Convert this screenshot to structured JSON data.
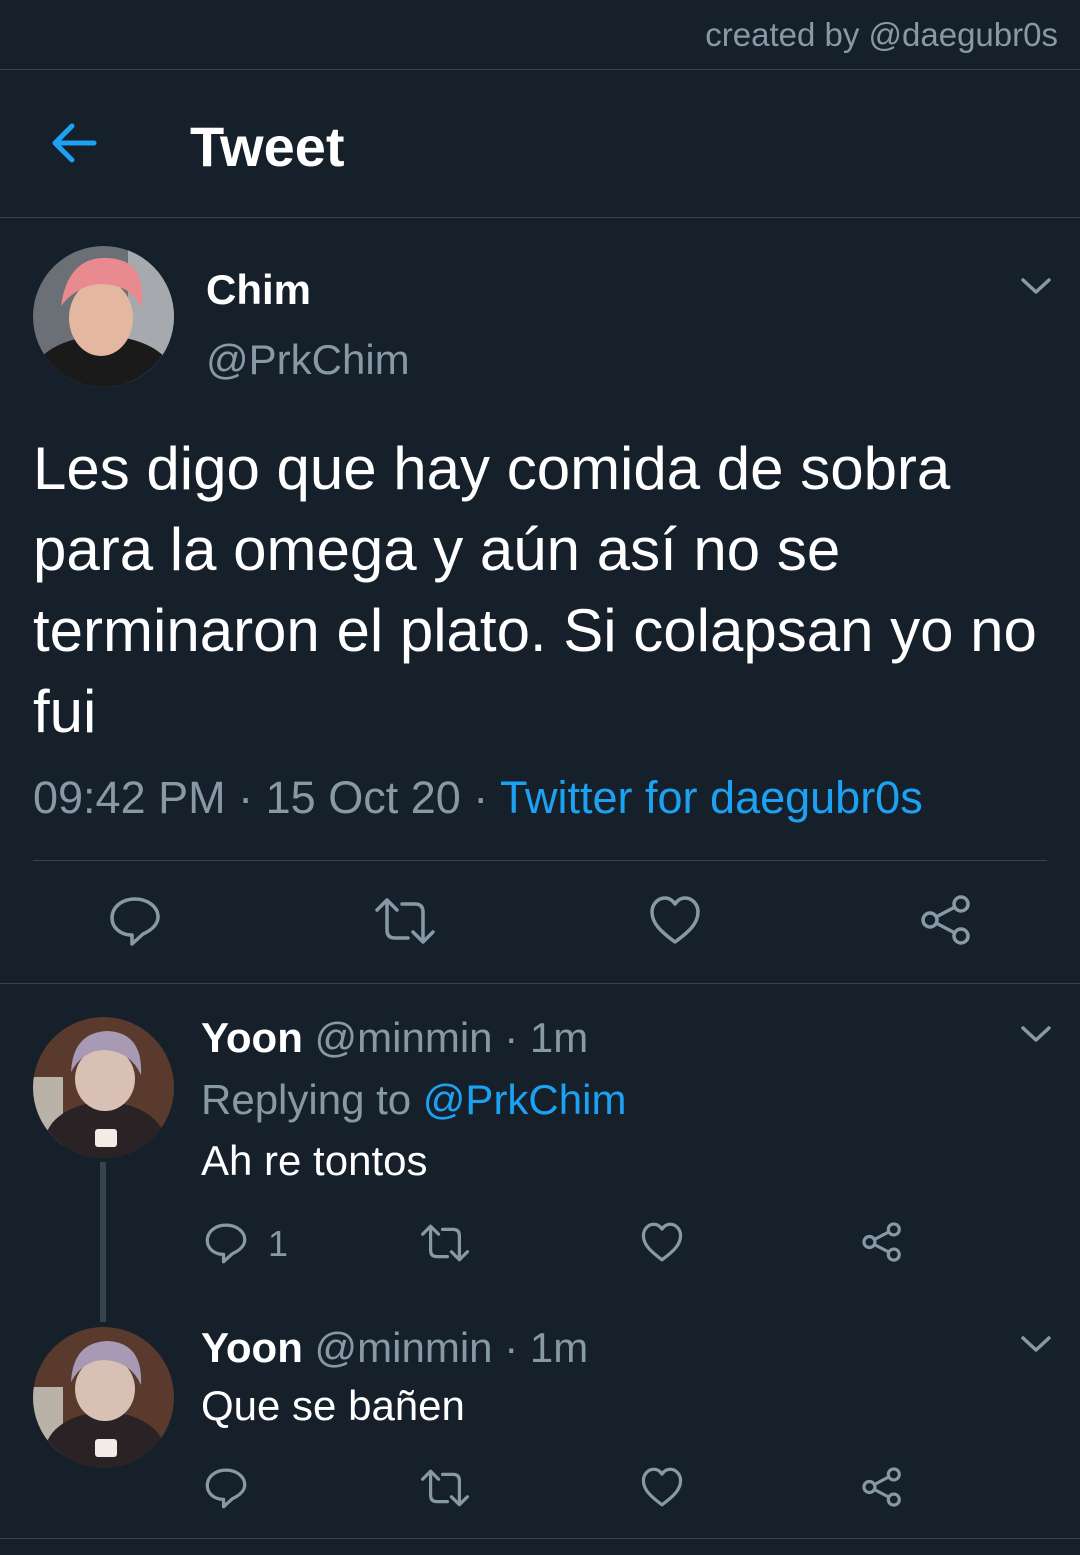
{
  "credit": "created by @daegubr0s",
  "header": {
    "title": "Tweet",
    "back_icon": "arrow-left-icon"
  },
  "colors": {
    "background": "#15202b",
    "accent": "#1da1f2",
    "muted": "#8899a6",
    "divider": "#38444d"
  },
  "tweet": {
    "name": "Chim",
    "handle": "@PrkChim",
    "text": "Les digo que hay comida de sobra para la omega y aún así no se terminaron el plato. Si colapsan yo no fui",
    "time": "09:42 PM",
    "date": "15 Oct 20",
    "separator": "·",
    "source": "Twitter for daegubr0s"
  },
  "replies": [
    {
      "name": "Yoon",
      "handle": "@minmin",
      "time": "1m",
      "replying_label": "Replying to",
      "replying_to": "@PrkChim",
      "text": "Ah re tontos",
      "reply_count": "1"
    },
    {
      "name": "Yoon",
      "handle": "@minmin",
      "time": "1m",
      "text": "Que se bañen"
    }
  ]
}
